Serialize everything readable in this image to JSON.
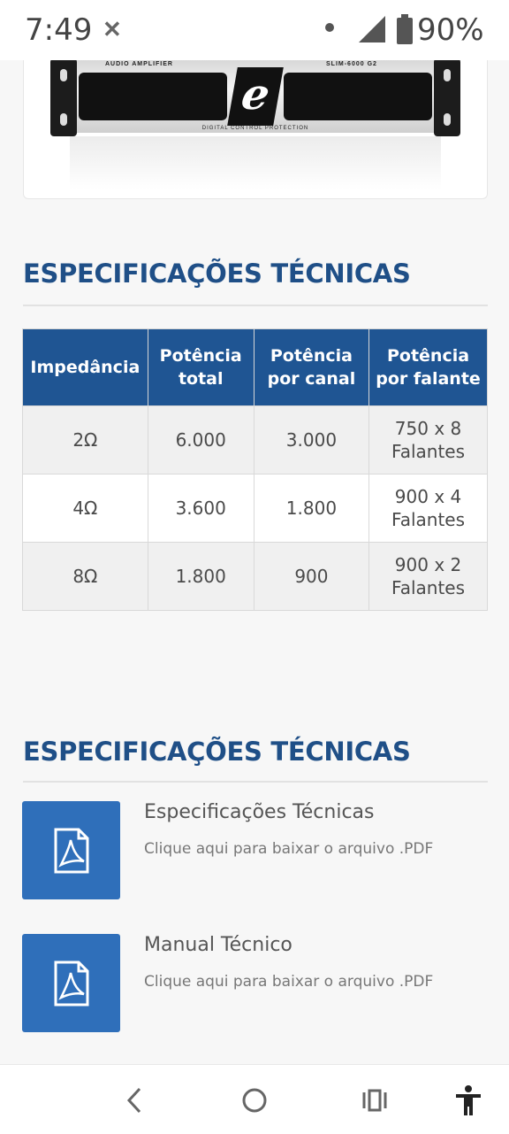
{
  "status_bar": {
    "time": "7:49",
    "notification_icon": "x-app-icon",
    "battery_percent": "90%",
    "battery_level": 0.9
  },
  "product_image": {
    "title": "AUDIO AMPLIFIER",
    "model": "SLIM-6000 G2",
    "logo_letter": "e",
    "bottom_text": "DIGITAL CONTROL PROTECTION"
  },
  "specs_section": {
    "title": "ESPECIFICAÇÕES TÉCNICAS",
    "headers": [
      "Impedância",
      "Potência total",
      "Potência por canal",
      "Potência por falante"
    ],
    "rows": [
      [
        "2Ω",
        "6.000",
        "3.000",
        "750 x 8 Falantes"
      ],
      [
        "4Ω",
        "3.600",
        "1.800",
        "900 x 4 Falantes"
      ],
      [
        "8Ω",
        "1.800",
        "900",
        "900 x 2 Falantes"
      ]
    ]
  },
  "downloads_section": {
    "title": "ESPECIFICAÇÕES TÉCNICAS",
    "items": [
      {
        "title": "Especificações Técnicas",
        "subtitle": "Clique aqui para baixar o arquivo .PDF",
        "icon": "pdf-icon"
      },
      {
        "title": "Manual Técnico",
        "subtitle": "Clique aqui para baixar o arquivo .PDF",
        "icon": "pdf-icon"
      }
    ]
  },
  "nav_bar": {
    "icons": [
      "back-icon",
      "home-icon",
      "recents-icon",
      "accessibility-icon"
    ]
  },
  "colors": {
    "brand_blue": "#1f4f87",
    "table_header": "#1f5593",
    "download_icon_bg": "#2f6fba"
  }
}
